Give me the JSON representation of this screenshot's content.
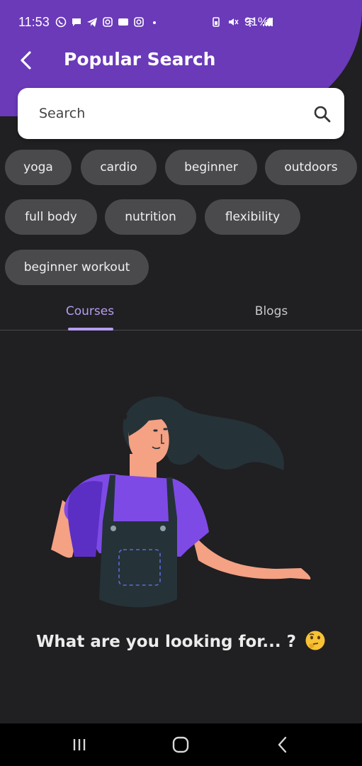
{
  "status_bar": {
    "time": "11:53",
    "battery": "91%"
  },
  "header": {
    "title": "Popular Search",
    "back_icon": "chevron-left-icon"
  },
  "search": {
    "placeholder": "Search",
    "icon": "search-icon"
  },
  "chips": [
    "yoga",
    "cardio",
    "beginner",
    "outdoors",
    "full body",
    "nutrition",
    "flexibility",
    "beginner workout"
  ],
  "tabs": {
    "courses": "Courses",
    "blogs": "Blogs",
    "selected": "Courses"
  },
  "empty_state": {
    "message": "What are you looking for... ?",
    "emoji": "thinking-face-emoji"
  },
  "colors": {
    "header": "#6a3ab9",
    "background": "#201f22",
    "chip": "#4a494c",
    "accent": "#b69ef0"
  },
  "nav": {
    "recents_icon": "recents-icon",
    "home_icon": "home-icon",
    "back_icon": "back-icon"
  }
}
